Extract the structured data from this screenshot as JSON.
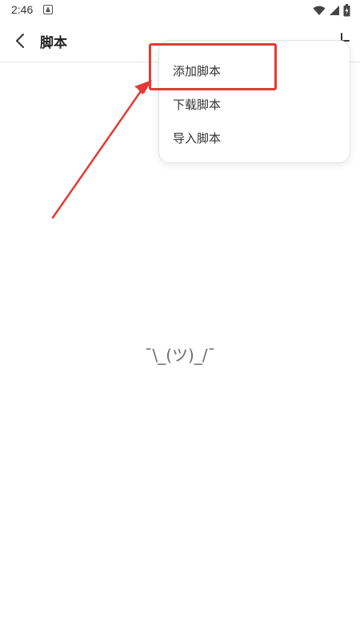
{
  "status_bar": {
    "time": "2:46",
    "icons": [
      "notification-icon",
      "wifi-icon",
      "signal-icon",
      "battery-icon"
    ]
  },
  "header": {
    "title": "脚本",
    "back_icon": "back-icon",
    "add_icon": "add-icon"
  },
  "menu": {
    "items": [
      {
        "label": "添加脚本"
      },
      {
        "label": "下载脚本"
      },
      {
        "label": "导入脚本"
      }
    ]
  },
  "empty_state": {
    "text": "¯\\_(ツ)_/¯"
  },
  "colors": {
    "annotation": "#e53935",
    "text": "#333333",
    "empty_text": "#6b6b6b"
  }
}
